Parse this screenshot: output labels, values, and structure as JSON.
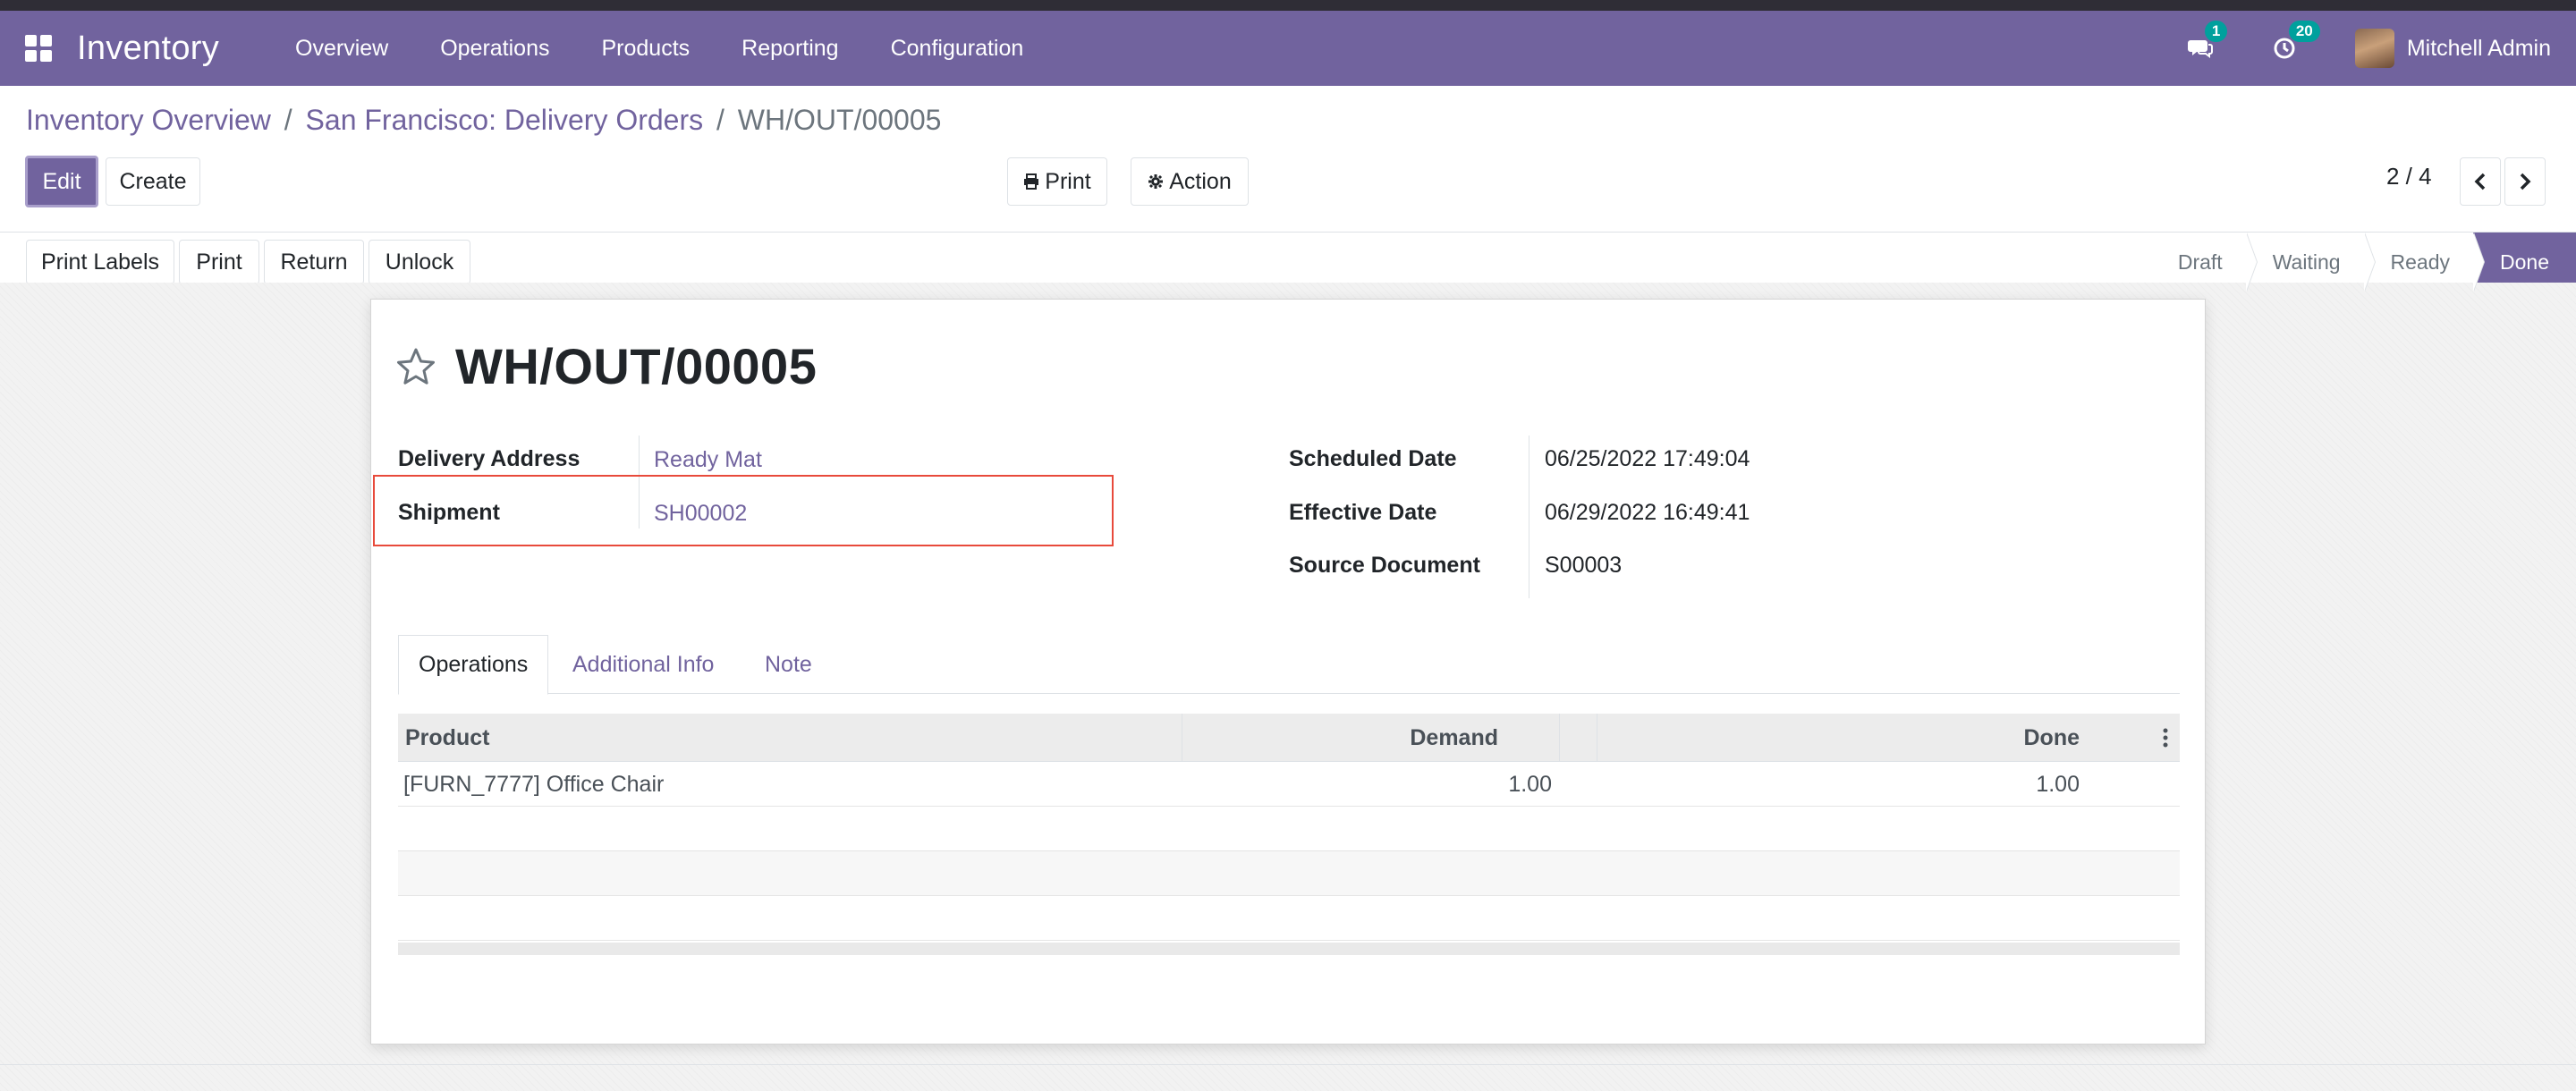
{
  "navbar": {
    "app_name": "Inventory",
    "menu": [
      "Overview",
      "Operations",
      "Products",
      "Reporting",
      "Configuration"
    ],
    "messages_badge": "1",
    "activities_badge": "20",
    "user_name": "Mitchell Admin"
  },
  "breadcrumb": {
    "items": [
      "Inventory Overview",
      "San Francisco: Delivery Orders"
    ],
    "current": "WH/OUT/00005",
    "separator": "/"
  },
  "controls": {
    "edit_label": "Edit",
    "create_label": "Create",
    "print_label": "Print",
    "action_label": "Action",
    "pager": "2 / 4"
  },
  "statusbar": {
    "buttons": [
      "Print Labels",
      "Print",
      "Return",
      "Unlock"
    ],
    "steps": [
      "Draft",
      "Waiting",
      "Ready",
      "Done"
    ],
    "active_step": "Done"
  },
  "record": {
    "title": "WH/OUT/00005",
    "fields_left": [
      {
        "label": "Delivery Address",
        "value": "Ready Mat"
      },
      {
        "label": "Shipment",
        "value": "SH00002"
      }
    ],
    "fields_right": [
      {
        "label": "Scheduled Date",
        "value": "06/25/2022 17:49:04"
      },
      {
        "label": "Effective Date",
        "value": "06/29/2022 16:49:41"
      },
      {
        "label": "Source Document",
        "value": "S00003"
      }
    ]
  },
  "tabs": [
    "Operations",
    "Additional Info",
    "Note"
  ],
  "table": {
    "headers": {
      "product": "Product",
      "demand": "Demand",
      "done": "Done"
    },
    "rows": [
      {
        "product": "[FURN_7777] Office Chair",
        "demand": "1.00",
        "done": "1.00"
      }
    ]
  },
  "colors": {
    "brand": "#71639e",
    "highlight": "#e84a3b",
    "badge": "#00a09d"
  }
}
